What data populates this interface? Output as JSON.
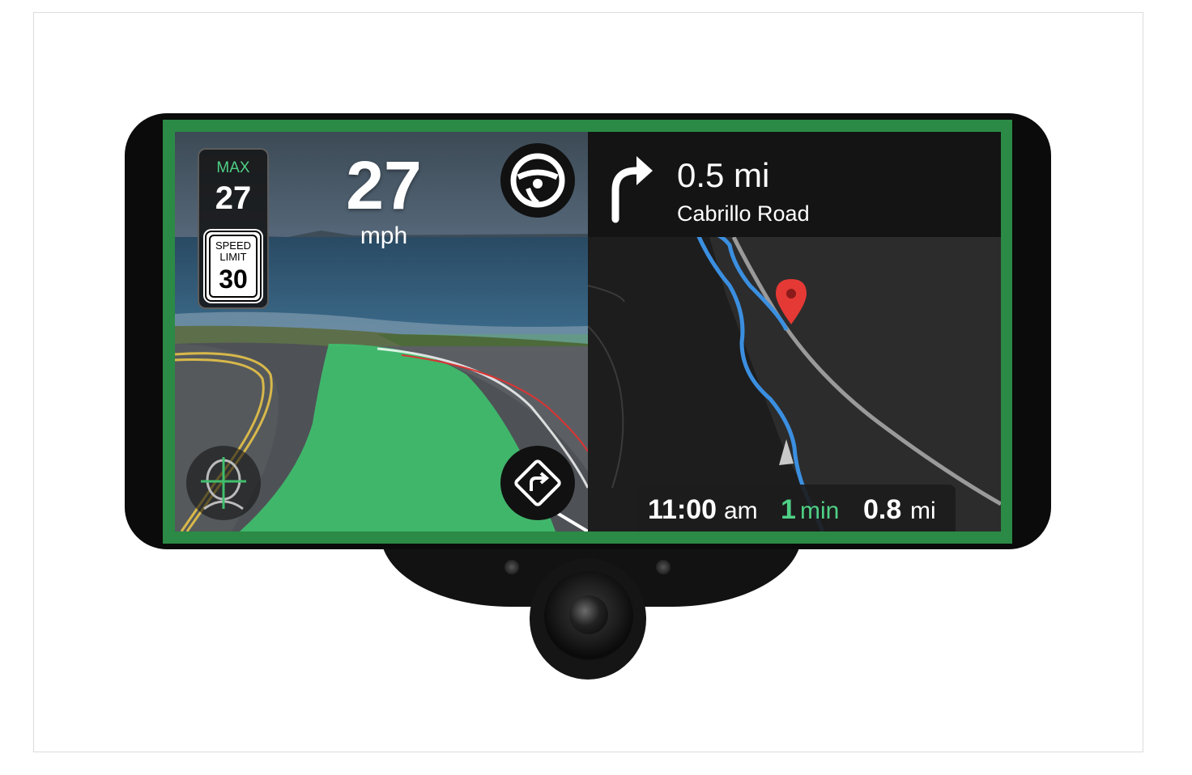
{
  "speed": {
    "max_label": "MAX",
    "max_value": "27",
    "sign_line1": "SPEED",
    "sign_line2": "LIMIT",
    "limit_value": "30",
    "current": "27",
    "unit": "mph"
  },
  "navigation": {
    "distance": "0.5 mi",
    "street": "Cabrillo Road",
    "turn_icon": "turn-right-arrow-icon"
  },
  "eta": {
    "arrival_time": "11:00",
    "arrival_period": "am",
    "duration_value": "1",
    "duration_unit": "min",
    "remaining_value": "0.8",
    "remaining_unit": "mi"
  },
  "icons": {
    "steering": "steering-wheel-icon",
    "driver_monitor": "driver-monitor-icon",
    "lane_turn": "turn-sign-icon",
    "destination": "destination-pin-icon",
    "vehicle": "vehicle-position-icon"
  },
  "colors": {
    "screen_border": "#2b8a45",
    "path_green": "#3fbf6c",
    "route_blue": "#3b8fe0",
    "max_label": "#4fd085",
    "eta_green": "#4fd085",
    "pin_red": "#e53935"
  }
}
